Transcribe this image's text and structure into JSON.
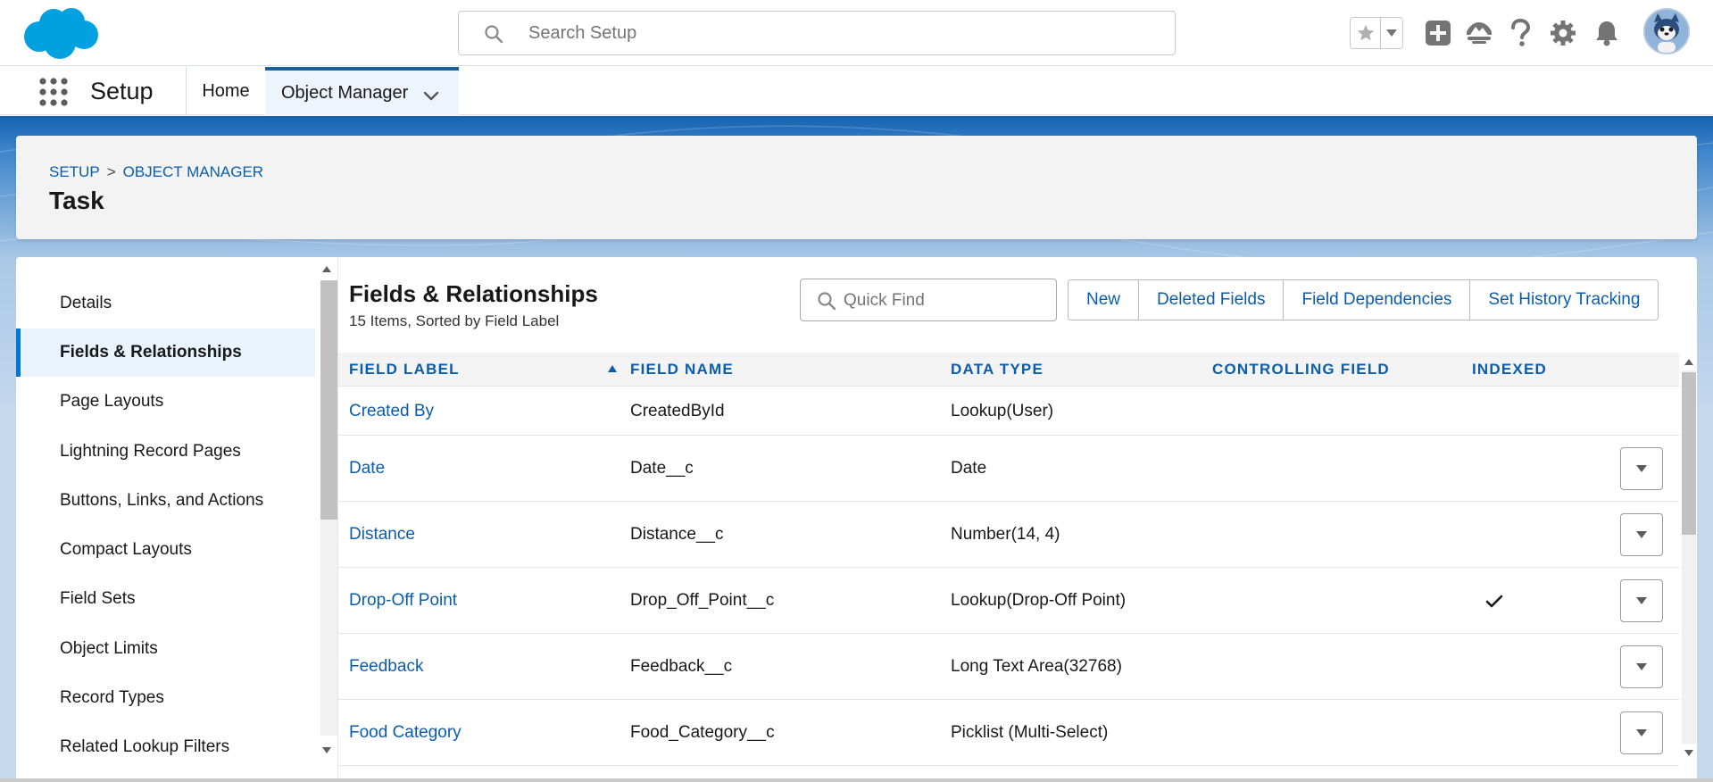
{
  "header": {
    "search_placeholder": "Search Setup"
  },
  "nav": {
    "app_name": "Setup",
    "tabs": [
      {
        "label": "Home"
      },
      {
        "label": "Object Manager"
      }
    ]
  },
  "page": {
    "breadcrumb": [
      "SETUP",
      ">",
      "OBJECT MANAGER"
    ],
    "title": "Task"
  },
  "sidebar": {
    "items": [
      {
        "label": "Details"
      },
      {
        "label": "Fields & Relationships",
        "active": true
      },
      {
        "label": "Page Layouts"
      },
      {
        "label": "Lightning Record Pages"
      },
      {
        "label": "Buttons, Links, and Actions"
      },
      {
        "label": "Compact Layouts"
      },
      {
        "label": "Field Sets"
      },
      {
        "label": "Object Limits"
      },
      {
        "label": "Record Types"
      },
      {
        "label": "Related Lookup Filters"
      }
    ]
  },
  "section": {
    "title": "Fields & Relationships",
    "subtitle": "15 Items, Sorted by Field Label",
    "quick_find_placeholder": "Quick Find",
    "buttons": [
      "New",
      "Deleted Fields",
      "Field Dependencies",
      "Set History Tracking"
    ]
  },
  "table": {
    "columns": [
      "FIELD LABEL",
      "FIELD NAME",
      "DATA TYPE",
      "CONTROLLING FIELD",
      "INDEXED"
    ],
    "rows": [
      {
        "label": "Created By",
        "name": "CreatedById",
        "type": "Lookup(User)",
        "controlling": "",
        "indexed": false,
        "actions": false
      },
      {
        "label": "Date",
        "name": "Date__c",
        "type": "Date",
        "controlling": "",
        "indexed": false,
        "actions": true
      },
      {
        "label": "Distance",
        "name": "Distance__c",
        "type": "Number(14, 4)",
        "controlling": "",
        "indexed": false,
        "actions": true
      },
      {
        "label": "Drop-Off Point",
        "name": "Drop_Off_Point__c",
        "type": "Lookup(Drop-Off Point)",
        "controlling": "",
        "indexed": true,
        "actions": true
      },
      {
        "label": "Feedback",
        "name": "Feedback__c",
        "type": "Long Text Area(32768)",
        "controlling": "",
        "indexed": false,
        "actions": true
      },
      {
        "label": "Food Category",
        "name": "Food_Category__c",
        "type": "Picklist (Multi-Select)",
        "controlling": "",
        "indexed": false,
        "actions": true
      }
    ]
  },
  "colors": {
    "brand_blue": "#0b5cab",
    "accent_blue": "#0176d3",
    "cloud_blue": "#00a1e0"
  },
  "icons": [
    "salesforce-cloud-logo",
    "search-icon",
    "star-icon",
    "chevron-down-icon",
    "add-icon",
    "trailhead-icon",
    "help-icon",
    "gear-icon",
    "bell-icon",
    "avatar",
    "app-launcher-icon",
    "sort-ascending-icon",
    "checkmark-icon"
  ]
}
